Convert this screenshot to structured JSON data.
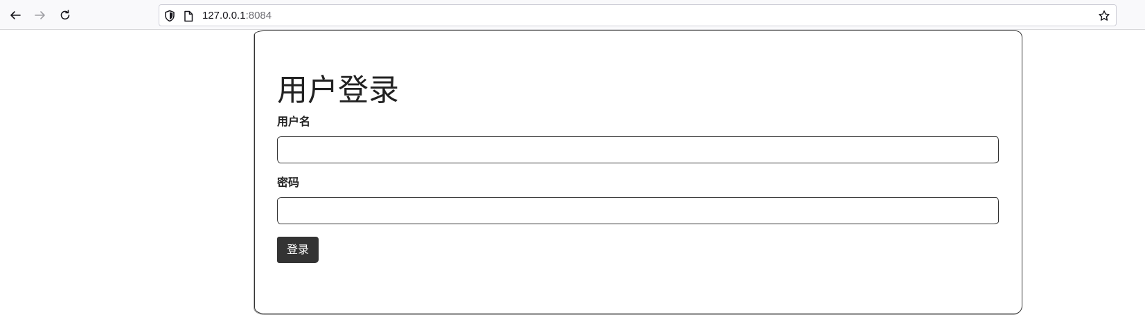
{
  "browser": {
    "url_host": "127.0.0.1",
    "url_port": ":8084",
    "icons": {
      "back": "arrow-left-icon",
      "forward": "arrow-right-icon",
      "reload": "reload-icon",
      "tracking": "shield-icon",
      "page": "page-icon",
      "bookmark": "star-icon"
    }
  },
  "login": {
    "title": "用户登录",
    "username_label": "用户名",
    "username_value": "",
    "password_label": "密码",
    "password_value": "",
    "submit_label": "登录"
  },
  "colors": {
    "button_bg": "#333333",
    "button_text": "#ffffff",
    "border": "#333333"
  }
}
